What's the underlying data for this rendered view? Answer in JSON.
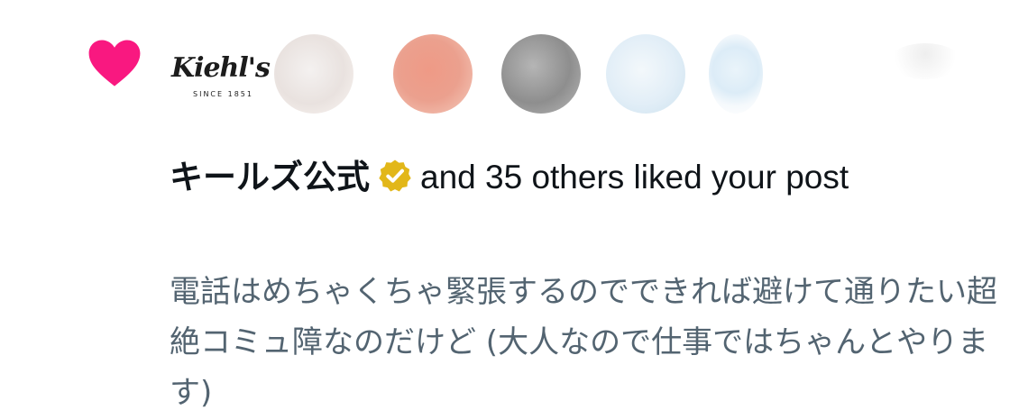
{
  "notification": {
    "type_icon": "heart-icon",
    "accent_color": "#f91880",
    "badge_color": "#e2b719",
    "brand_avatar": {
      "script": "Kiehl's",
      "since": "SINCE 1851"
    },
    "actor_name": "キールズ公式",
    "verified_icon": "verified-badge-icon",
    "summary_rest": "and 35 others liked your post",
    "post_text": "電話はめちゃくちゃ緊張するのでできれば避けて通りたい超絶コミュ障なのだけど (大人なので仕事ではちゃんとやります)"
  }
}
